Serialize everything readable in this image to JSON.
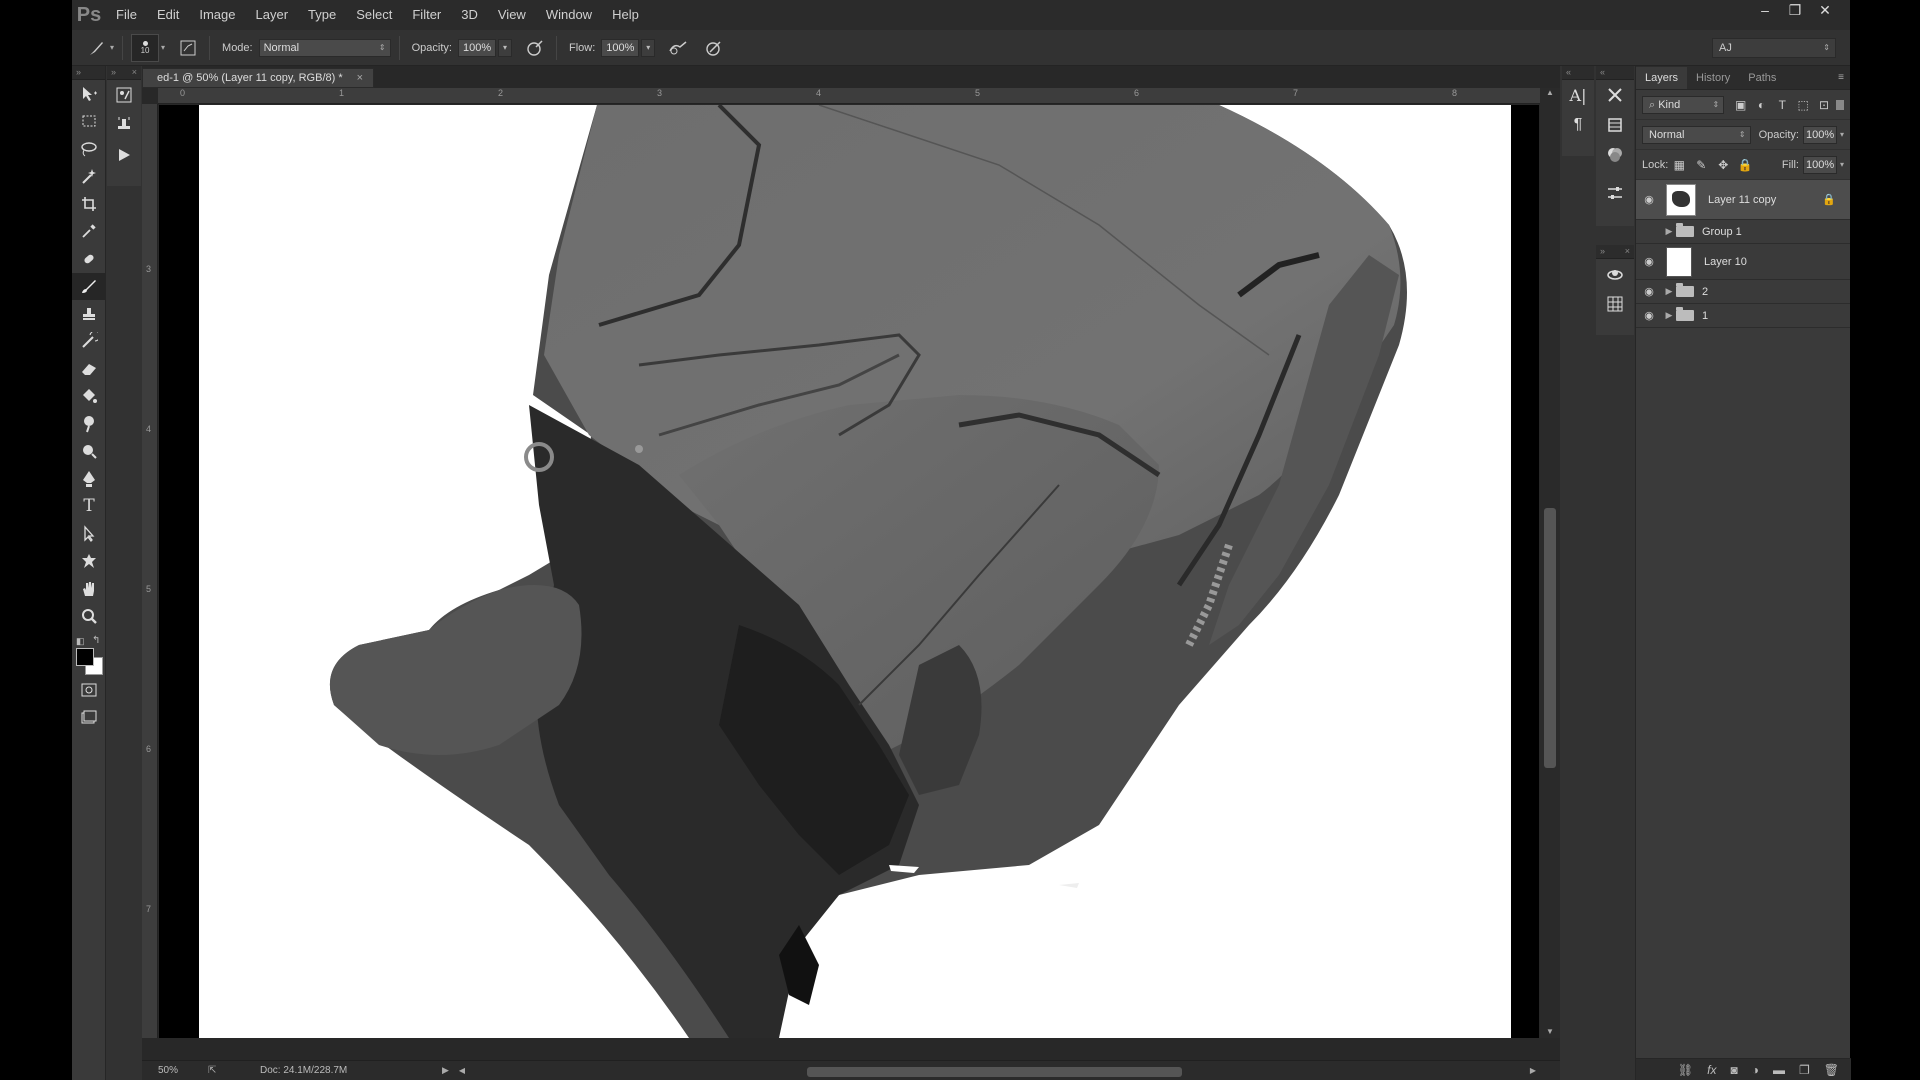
{
  "app": {
    "logo": "Ps",
    "menus": [
      "File",
      "Edit",
      "Image",
      "Layer",
      "Type",
      "Select",
      "Filter",
      "3D",
      "View",
      "Window",
      "Help"
    ],
    "window_controls": [
      "–",
      "❐",
      "✕"
    ]
  },
  "options": {
    "brush_size": "10",
    "mode_label": "Mode:",
    "mode_value": "Normal",
    "opacity_label": "Opacity:",
    "opacity_value": "100%",
    "flow_label": "Flow:",
    "flow_value": "100%",
    "workspace": "AJ"
  },
  "document": {
    "tab_title": "ed-1 @ 50% (Layer 11 copy, RGB/8) *",
    "close": "×",
    "ruler_top": [
      "0",
      "1",
      "2",
      "3",
      "4",
      "5",
      "6",
      "7",
      "8"
    ],
    "ruler_left": [
      "3",
      "4",
      "5",
      "6",
      "7",
      "8"
    ],
    "zoom": "50%",
    "doc_info": "Doc: 24.1M/228.7M"
  },
  "layers_panel": {
    "tabs": [
      "Layers",
      "History",
      "Paths"
    ],
    "filter_kind": "Kind",
    "blend_mode": "Normal",
    "opacity_label": "Opacity:",
    "opacity_value": "100%",
    "lock_label": "Lock:",
    "fill_label": "Fill:",
    "fill_value": "100%",
    "layers": [
      {
        "name": "Layer 11 copy",
        "type": "layer",
        "visible": true,
        "selected": true,
        "locked": true
      },
      {
        "name": "Group 1",
        "type": "group",
        "visible": false
      },
      {
        "name": "Layer 10",
        "type": "layer",
        "visible": true
      },
      {
        "name": "2",
        "type": "group",
        "visible": true
      },
      {
        "name": "1",
        "type": "group",
        "visible": true
      }
    ],
    "bottom_icons": [
      "link-icon",
      "fx-icon",
      "mask-icon",
      "adjustment-icon",
      "folder-icon",
      "new-layer-icon",
      "trash-icon"
    ]
  }
}
